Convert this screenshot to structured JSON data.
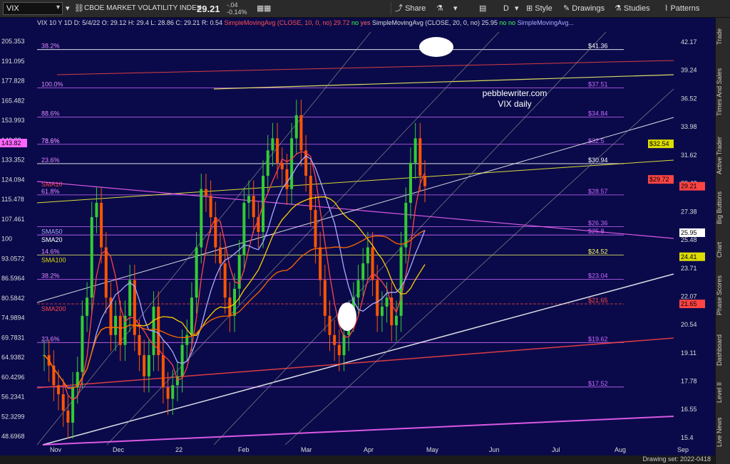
{
  "toolbar": {
    "symbol": "VIX",
    "name": "CBOE MARKET VOLATILITY INDEX",
    "last": "29.21",
    "change": "-.04",
    "change_pct": "-0.14%",
    "share": "Share",
    "interval": "D",
    "style": "Style",
    "drawings": "Drawings",
    "studies": "Studies",
    "patterns": "Patterns"
  },
  "legend": {
    "header": "VIX 10 Y 1D",
    "date": "D: 5/4/22",
    "open": "O: 29.12",
    "high": "H: 29.4",
    "low": "L: 28.86",
    "close": "C: 29.21",
    "range": "R: 0.54",
    "sma10": "SimpleMovingAvg (CLOSE, 10, 0, no)",
    "sma10_val": "29.72",
    "no1": "no",
    "yes1": "yes",
    "sma20": "SimpleMovingAvg (CLOSE, 20, 0, no)",
    "sma20_val": "25.95",
    "no2": "no",
    "no3": "no",
    "sma50": "SimpleMovingAvg..."
  },
  "chart_data": {
    "type": "candlestick",
    "title": "pebblewriter.com",
    "subtitle": "VIX daily",
    "x_ticks": [
      "Nov",
      "Dec",
      "22",
      "Feb",
      "Mar",
      "Apr",
      "May",
      "Jun",
      "Jul",
      "Aug",
      "Sep"
    ],
    "left_axis_ticks": [
      205.353,
      191.095,
      177.828,
      165.482,
      153.993,
      143.82,
      133.352,
      124.094,
      115.478,
      107.461,
      100,
      93.0572,
      86.5964,
      80.5842,
      74.9894,
      69.7831,
      64.9382,
      60.4296,
      56.2341,
      52.3299,
      48.6968
    ],
    "right_axis_ticks": [
      42.17,
      39.24,
      36.52,
      33.98,
      31.62,
      29.42,
      27.38,
      25.48,
      23.71,
      22.07,
      20.54,
      19.11,
      17.78,
      16.55,
      15.4
    ],
    "fib_left_labels": [
      "38.2%",
      "100.0%",
      "88.6%",
      "78.6%",
      "23.6%",
      "61.8%",
      "38.2%",
      "23.6%",
      "78.6%",
      "14.6%"
    ],
    "fib_right_labels": [
      "$41.36",
      "$37.51",
      "$34.84",
      "$32.5",
      "$30.94",
      "$28.57",
      "$26.36",
      "$25.8",
      "$24.52",
      "$23.04",
      "$21.65",
      "$19.62",
      "$17.52"
    ],
    "ma_labels": [
      "SMA10",
      "SMA50",
      "SMA20",
      "SMA100",
      "SMA200"
    ],
    "price_tags": [
      {
        "text": "143.82",
        "color": "#ff66ff"
      },
      {
        "text": "$32.54",
        "color": "#dddd00"
      },
      {
        "text": "$29.72",
        "color": "#ff4444"
      },
      {
        "text": "29.21",
        "color": "#ff4444"
      },
      {
        "text": "25.95",
        "color": "#ffffff"
      },
      {
        "text": "24.41",
        "color": "#dddd00"
      },
      {
        "text": "21.65",
        "color": "#ff4444"
      }
    ],
    "candles_close": [
      19.0,
      18.5,
      17.6,
      17.2,
      16.5,
      16.0,
      17.5,
      18.2,
      21.0,
      22.0,
      27.0,
      28.0,
      25.0,
      22.0,
      20.0,
      21.0,
      19.5,
      21.0,
      23.0,
      20.0,
      19.0,
      18.0,
      19.0,
      21.5,
      19.0,
      17.5,
      17.0,
      17.6,
      18.0,
      19.5,
      20.0,
      22.0,
      25.0,
      29.0,
      28.5,
      27.0,
      25.0,
      24.0,
      22.0,
      21.0,
      22.5,
      24.5,
      28.0,
      28.5,
      27.0,
      26.0,
      30.0,
      32.0,
      33.0,
      31.0,
      30.5,
      29.0,
      33.0,
      35.0,
      32.0,
      30.0,
      27.5,
      25.0,
      23.0,
      21.0,
      20.0,
      19.5,
      19.0,
      20.0,
      21.0,
      22.0,
      23.0,
      24.0,
      25.0,
      23.0,
      21.0,
      21.5,
      22.0,
      20.5,
      21.0,
      25.0,
      28.0,
      31.0,
      33.0,
      30.0,
      29.21
    ]
  },
  "rail": {
    "items": [
      "Trade",
      "Times And Sales",
      "Active Trader",
      "Big Buttons",
      "Chart",
      "Phase Scores",
      "Dashboard",
      "Level II",
      "Live News"
    ]
  },
  "footer": {
    "drawing_set": "Drawing set: 2022-0418"
  }
}
